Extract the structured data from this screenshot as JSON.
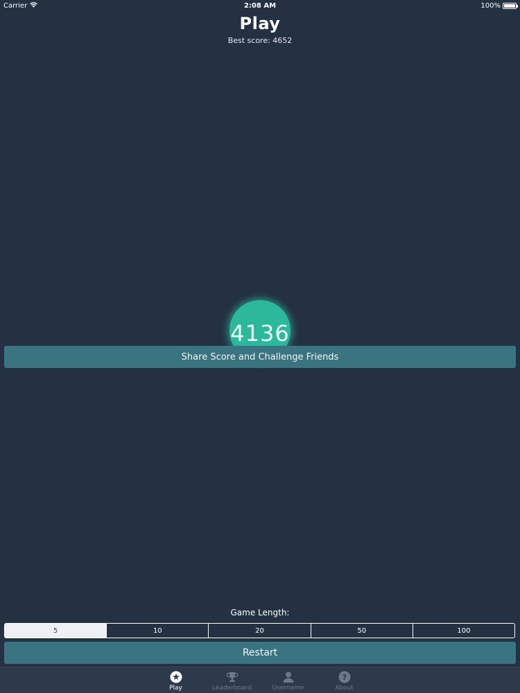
{
  "status_bar": {
    "carrier": "Carrier",
    "time": "2:08 AM",
    "battery": "100%"
  },
  "header": {
    "title": "Play",
    "best_score": "Best score: 4652"
  },
  "score": {
    "value": "4136"
  },
  "share": {
    "label": "Share Score and Challenge Friends"
  },
  "game_length": {
    "label": "Game Length:",
    "options": [
      "5",
      "10",
      "20",
      "50",
      "100"
    ],
    "selected": "5"
  },
  "restart": {
    "label": "Restart"
  },
  "tabs": [
    {
      "label": "Play",
      "icon": "play-icon",
      "active": true
    },
    {
      "label": "Leaderboard",
      "icon": "trophy-icon",
      "active": false
    },
    {
      "label": "Username",
      "icon": "person-icon",
      "active": false
    },
    {
      "label": "About",
      "icon": "question-icon",
      "active": false
    }
  ],
  "colors": {
    "background": "#243142",
    "accent_button": "#3b7481",
    "score_bubble": "#2bb89b",
    "tab_bar": "#2e3a4b"
  }
}
